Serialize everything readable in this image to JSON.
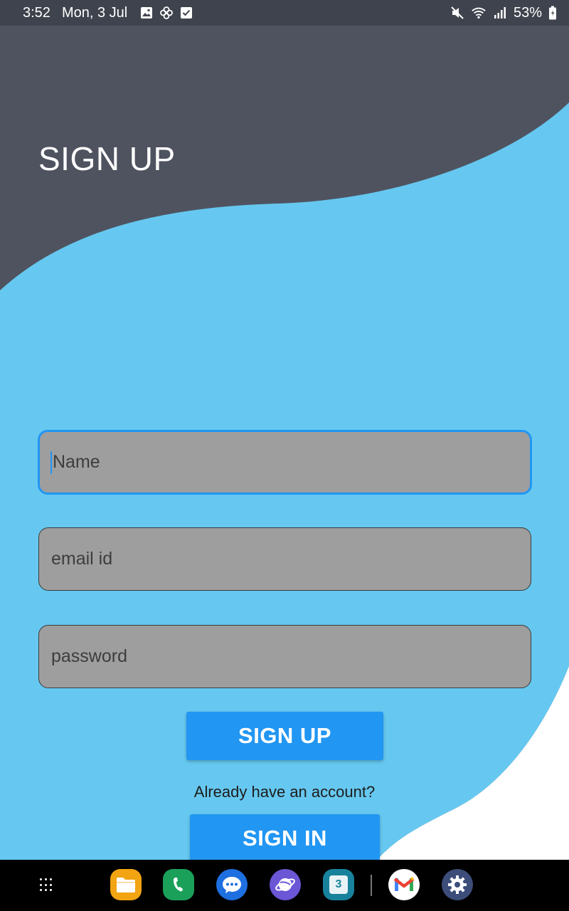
{
  "status_bar": {
    "time": "3:52",
    "date": "Mon, 3 Jul",
    "battery": "53%",
    "left_icons": [
      "gallery-icon",
      "pinwheel-icon",
      "checkbox-icon"
    ],
    "right_icons": [
      "mute-icon",
      "wifi-icon",
      "signal-icon",
      "battery-icon"
    ]
  },
  "header": {
    "title": "SIGN UP"
  },
  "form": {
    "name_placeholder": "Name",
    "email_placeholder": "email id",
    "password_placeholder": "password",
    "signup_label": "SIGN UP",
    "already_text": "Already have an account?",
    "signin_label": "SIGN IN"
  },
  "dock": {
    "apps": [
      "My Files",
      "Phone",
      "Messages",
      "Internet",
      "Calendar",
      "Gmail",
      "Settings"
    ],
    "calendar_day": "3"
  },
  "colors": {
    "dark_wave": "#4f5360",
    "light_wave": "#66c8f0",
    "accent": "#2196f3",
    "field_bg": "#9e9e9e"
  }
}
